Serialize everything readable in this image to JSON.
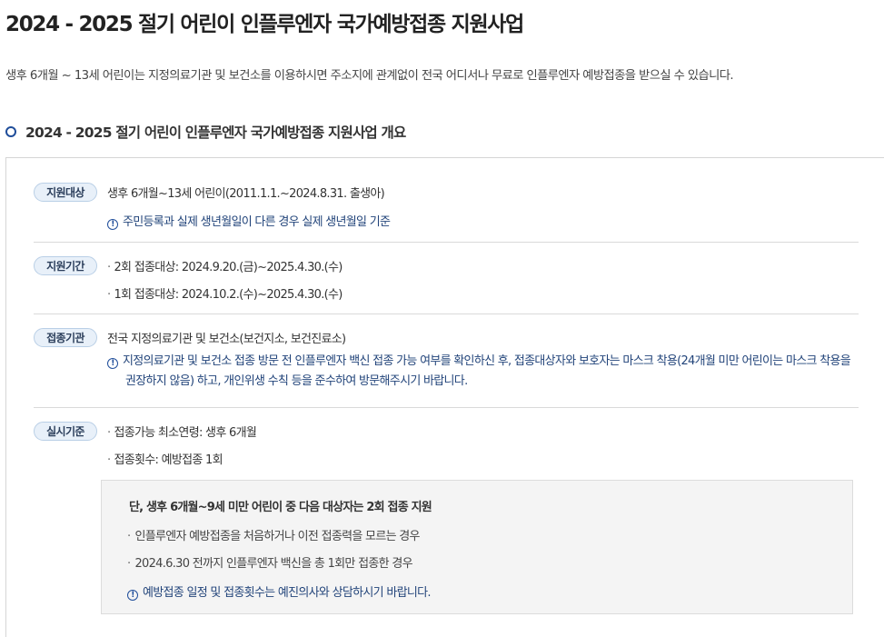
{
  "page": {
    "title": "2024 - 2025 절기 어린이 인플루엔자 국가예방접종 지원사업",
    "intro": "생후 6개월 ~ 13세 어린이는 지정의료기관 및 보건소를 이용하시면 주소지에 관계없이 전국 어디서나 무료로 인플루엔자 예방접종을 받으실 수 있습니다."
  },
  "section": {
    "title": "2024 - 2025 절기 어린이 인플루엔자 국가예방접종 지원사업 개요"
  },
  "rows": {
    "target": {
      "label": "지원대상",
      "line1": "생후 6개월~13세 어린이(2011.1.1.~2024.8.31. 출생아)",
      "notice": "주민등록과 실제 생년월일이 다른 경우 실제 생년월일 기준"
    },
    "period": {
      "label": "지원기간",
      "line1": "2회 접종대상: 2024.9.20.(금)~2025.4.30.(수)",
      "line2": "1회 접종대상: 2024.10.2.(수)~2025.4.30.(수)"
    },
    "institution": {
      "label": "접종기관",
      "line1": "전국 지정의료기관 및 보건소(보건지소, 보건진료소)",
      "notice_part1": "지정의료기관 및 보건소 접종 방문 전 인플루엔자 백신 접종 가능 여부를 확인하신 후, 접종대상자와 보호자는 마스크 착용(24개월 미만 어린이는 마스크 착용을",
      "notice_part2": "권장하지 않음) 하고, 개인위생 수칙 등을 준수하여 방문해주시기 바랍니다."
    },
    "criteria": {
      "label": "실시기준",
      "line1": "접종가능 최소연령: 생후 6개월",
      "line2": "접종횟수: 예방접종 1회"
    }
  },
  "sub_box": {
    "title": "단, 생후 6개월~9세 미만 어린이 중 다음 대상자는 2회 접종 지원",
    "item1": "인플루엔자 예방접종을 처음하거나 이전 접종력을 모르는 경우",
    "item2": "2024.6.30 전까지 인플루엔자 백신을 총 1회만 접종한 경우",
    "notice": "예방접종 일정 및 접종횟수는 예진의사와 상담하시기 바랍니다."
  },
  "icons": {
    "notice_icon": "info-circle-icon",
    "section_bullet": "circle-bullet-icon"
  },
  "colors": {
    "accent": "#1f4d9a",
    "label_bg": "#e8f0f9",
    "label_border": "#b9cfe6",
    "notice_text": "#22447a",
    "sub_box_bg": "#f4f4f4"
  }
}
